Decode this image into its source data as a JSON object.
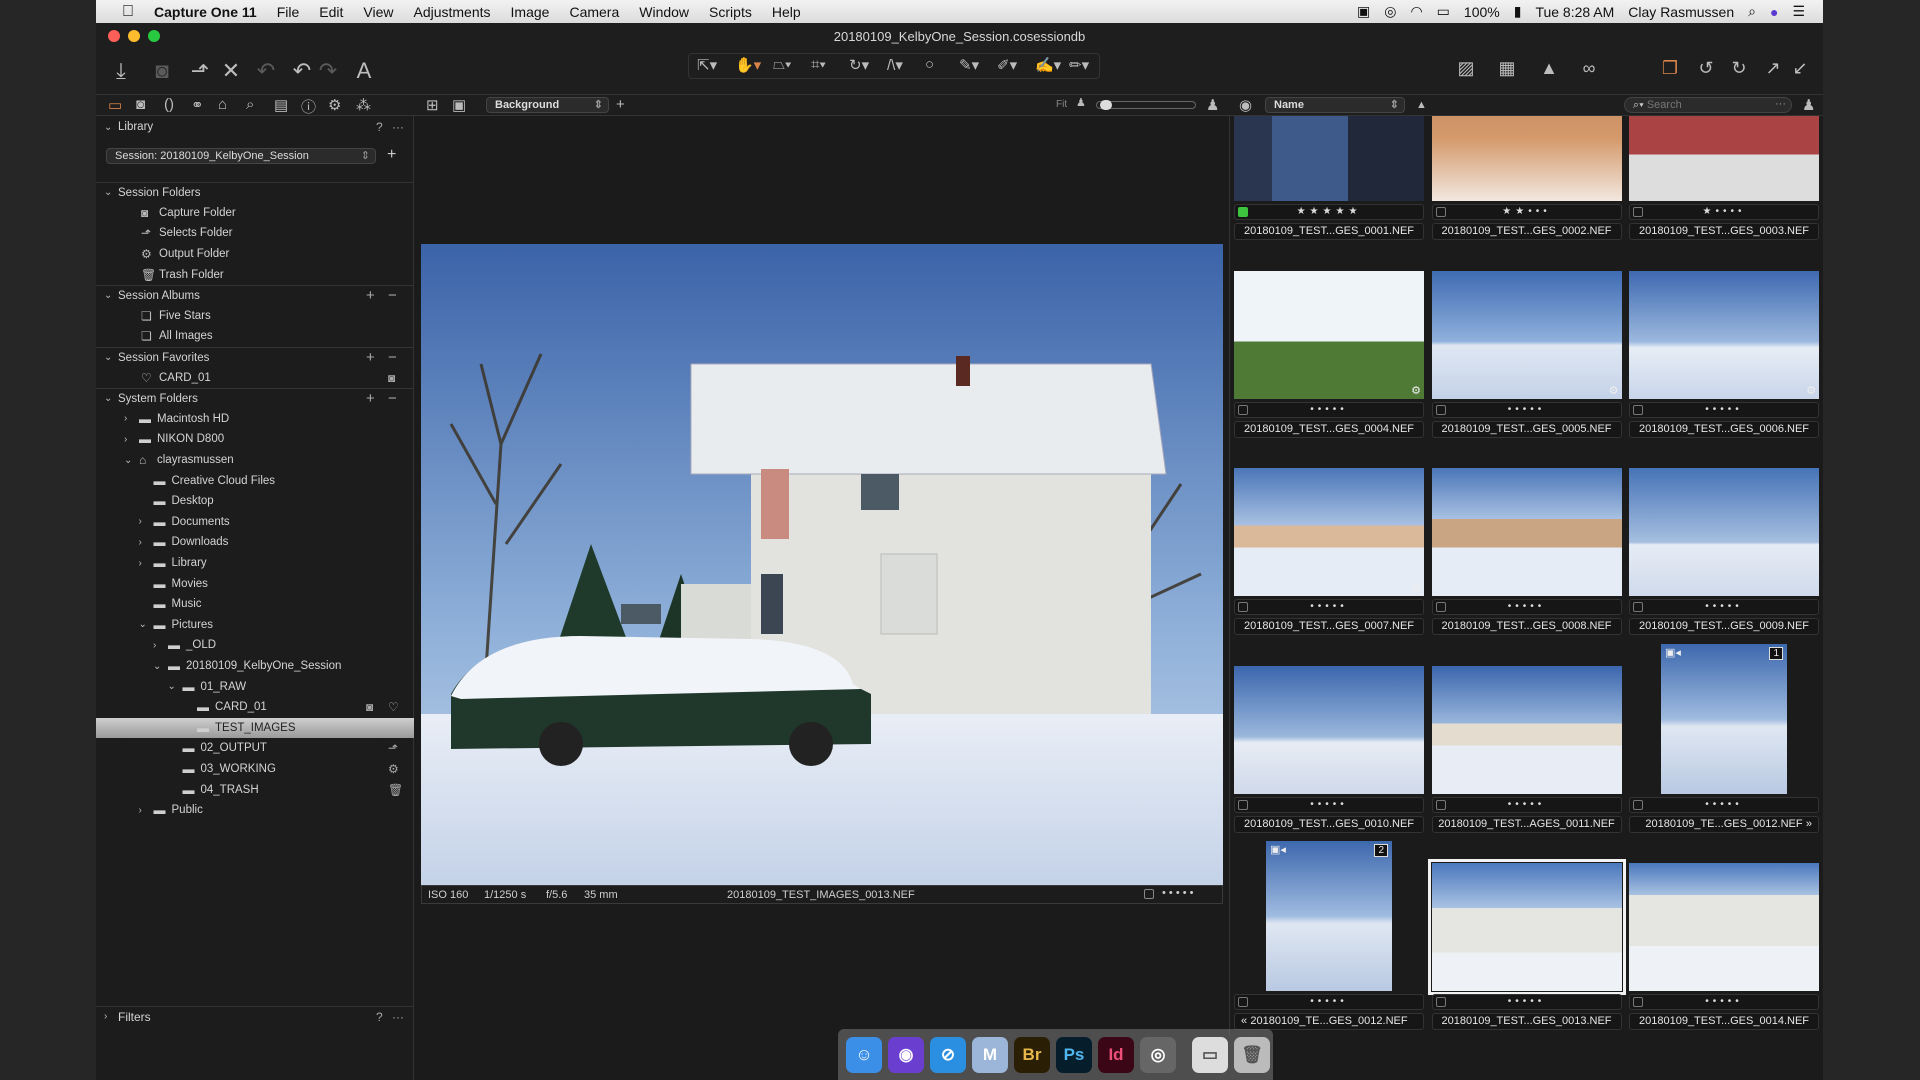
{
  "menubar": {
    "apple": "",
    "app": "Capture One 11",
    "items": [
      "File",
      "Edit",
      "View",
      "Adjustments",
      "Image",
      "Camera",
      "Window",
      "Scripts",
      "Help"
    ],
    "battery": "100%",
    "clock": "Tue 8:28 AM",
    "user": "Clay Rasmussen"
  },
  "window": {
    "title": "20180109_KelbyOne_Session.cosessiondb"
  },
  "toolbar": {
    "text_tool": "A"
  },
  "viewer_tabs": {
    "background_select": "Background",
    "fit_label": "Fit"
  },
  "browser_tabs": {
    "sort_select": "Name",
    "search_placeholder": "Search"
  },
  "library": {
    "title": "Library",
    "help": "?",
    "more": "···",
    "session_select": "Session: 20180109_KelbyOne_Session"
  },
  "tree": [
    {
      "label": "Session Folders",
      "section": true,
      "expanded": true,
      "level": 0
    },
    {
      "label": "Capture Folder",
      "icon": "camera-icon",
      "level": 0
    },
    {
      "label": "Selects Folder",
      "icon": "selects-icon",
      "level": 0
    },
    {
      "label": "Output Folder",
      "icon": "gear-icon",
      "level": 0
    },
    {
      "label": "Trash Folder",
      "icon": "trash-icon",
      "level": 0
    },
    {
      "label": "Session Albums",
      "section": true,
      "expanded": true,
      "plusminus": true,
      "level": 0
    },
    {
      "label": "Five Stars",
      "icon": "smart-album-icon",
      "level": 0
    },
    {
      "label": "All Images",
      "icon": "smart-album-icon",
      "level": 0
    },
    {
      "label": "Session Favorites",
      "section": true,
      "expanded": true,
      "plusminus": true,
      "level": 0
    },
    {
      "label": "CARD_01",
      "icon": "heart-icon",
      "level": 0,
      "right": [
        "camera-icon"
      ]
    },
    {
      "label": "System Folders",
      "section": true,
      "expanded": true,
      "plusminus": true,
      "level": 0
    },
    {
      "label": "Macintosh HD",
      "icon": "drive-icon",
      "level": 0,
      "arrow": "collapsed"
    },
    {
      "label": "NIKON D800",
      "icon": "drive-icon",
      "level": 0,
      "arrow": "collapsed"
    },
    {
      "label": "clayrasmussen",
      "icon": "home-icon",
      "level": 0,
      "arrow": "expanded"
    },
    {
      "label": "Creative Cloud Files",
      "icon": "folder-icon",
      "level": 1
    },
    {
      "label": "Desktop",
      "icon": "folder-icon",
      "level": 1
    },
    {
      "label": "Documents",
      "icon": "folder-icon",
      "level": 1,
      "arrow": "collapsed"
    },
    {
      "label": "Downloads",
      "icon": "folder-icon",
      "level": 1,
      "arrow": "collapsed"
    },
    {
      "label": "Library",
      "icon": "folder-icon",
      "level": 1,
      "arrow": "collapsed"
    },
    {
      "label": "Movies",
      "icon": "folder-icon",
      "level": 1
    },
    {
      "label": "Music",
      "icon": "folder-icon",
      "level": 1
    },
    {
      "label": "Pictures",
      "icon": "folder-icon",
      "level": 1,
      "arrow": "expanded"
    },
    {
      "label": "_OLD",
      "icon": "folder-icon",
      "level": 2,
      "arrow": "collapsed"
    },
    {
      "label": "20180109_KelbyOne_Session",
      "icon": "folder-icon",
      "level": 2,
      "arrow": "expanded"
    },
    {
      "label": "01_RAW",
      "icon": "folder-icon",
      "level": 3,
      "arrow": "expanded"
    },
    {
      "label": "CARD_01",
      "icon": "folder-icon",
      "level": 4,
      "right": [
        "camera-icon",
        "heart-icon"
      ]
    },
    {
      "label": "TEST_IMAGES",
      "icon": "folder-icon",
      "level": 4,
      "selected": true
    },
    {
      "label": "02_OUTPUT",
      "icon": "folder-icon",
      "level": 3,
      "right": [
        "selects-icon"
      ]
    },
    {
      "label": "03_WORKING",
      "icon": "folder-icon",
      "level": 3,
      "right": [
        "gear-icon"
      ]
    },
    {
      "label": "04_TRASH",
      "icon": "folder-icon",
      "level": 3,
      "right": [
        "trash-icon"
      ]
    },
    {
      "label": "Public",
      "icon": "folder-icon",
      "level": 1,
      "arrow": "collapsed"
    }
  ],
  "filters": {
    "title": "Filters",
    "help": "?",
    "more": "···"
  },
  "viewer": {
    "iso": "ISO 160",
    "shutter": "1/1250 s",
    "aperture": "f/5.6",
    "focal": "35 mm",
    "filename": "20180109_TEST_IMAGES_0013.NEF",
    "rating_dots": "• • • • •"
  },
  "thumbnails": [
    {
      "name": "20180109_TEST...GES_0001.NEF",
      "rating": 5,
      "color_tag": "#3ec43e"
    },
    {
      "name": "20180109_TEST...GES_0002.NEF",
      "rating": 2
    },
    {
      "name": "20180109_TEST...GES_0003.NEF",
      "rating": 1
    },
    {
      "name": "20180109_TEST...GES_0004.NEF",
      "rating": 0
    },
    {
      "name": "20180109_TEST...GES_0005.NEF",
      "rating": 0
    },
    {
      "name": "20180109_TEST...GES_0006.NEF",
      "rating": 0
    },
    {
      "name": "20180109_TEST...GES_0007.NEF",
      "rating": 0
    },
    {
      "name": "20180109_TEST...GES_0008.NEF",
      "rating": 0
    },
    {
      "name": "20180109_TEST...GES_0009.NEF",
      "rating": 0
    },
    {
      "name": "20180109_TEST...GES_0010.NEF",
      "rating": 0
    },
    {
      "name": "20180109_TEST...AGES_0011.NEF",
      "rating": 0
    },
    {
      "name": "20180109_TE...GES_0012.NEF",
      "rating": 0,
      "variant_badge": "1",
      "suffix": "»",
      "portrait": true
    },
    {
      "name": "20180109_TE...GES_0012.NEF",
      "rating": 0,
      "variant_badge": "2",
      "prefix": "«",
      "portrait": true
    },
    {
      "name": "20180109_TEST...GES_0013.NEF",
      "rating": 0,
      "selected": true
    },
    {
      "name": "20180109_TEST...GES_0014.NEF",
      "rating": 0
    }
  ],
  "dock": [
    {
      "name": "Finder",
      "label": "☺",
      "color": "#3b8fe6"
    },
    {
      "name": "Siri",
      "label": "◉",
      "color": "#6a3fd0"
    },
    {
      "name": "Safari",
      "label": "⊘",
      "color": "#2a8fe0"
    },
    {
      "name": "Migration",
      "label": "M",
      "color": "#9bb6d8"
    },
    {
      "name": "Bridge",
      "label": "Br",
      "color": "#2a1e05"
    },
    {
      "name": "Photoshop",
      "label": "Ps",
      "color": "#061d2c"
    },
    {
      "name": "InDesign",
      "label": "Id",
      "color": "#3b0716"
    },
    {
      "name": "Capture One",
      "label": "◎",
      "color": "#666"
    },
    {
      "name": "SD Card",
      "label": "▭",
      "color": "#ddd"
    },
    {
      "name": "Trash",
      "label": "🗑",
      "color": "#bbb"
    }
  ]
}
